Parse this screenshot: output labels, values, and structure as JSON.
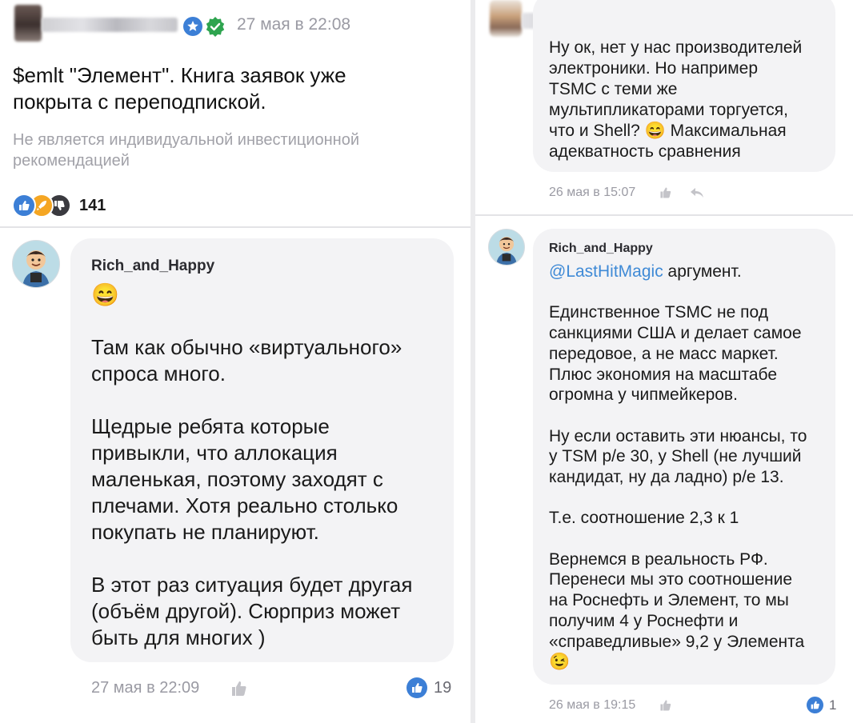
{
  "left": {
    "post": {
      "timestamp": "27 мая в 22:08",
      "text_line1": "$emlt \"Элемент\". Книга заявок уже",
      "text_line2": "покрыта с переподпиской.",
      "disclaimer_line1": "Не является индивидуальной инвестиционной",
      "disclaimer_line2": "рекомендацией",
      "reactions_count": "141"
    },
    "comment": {
      "author": "Rich_and_Happy",
      "emoji": "😄",
      "p1_l1": "Там как обычно «виртуального»",
      "p1_l2": "спроса много.",
      "p2_l1": "Щедрые ребята которые",
      "p2_l2": "привыкли, что аллокация",
      "p2_l3": "маленькая, поэтому заходят с",
      "p2_l4": "плечами. Хотя реально столько",
      "p2_l5": "покупать не планируют.",
      "p3_l1": "В этот раз ситуация будет другая",
      "p3_l2": "(объём другой). Сюрприз может",
      "p3_l3": "быть для многих )",
      "timestamp": "27 мая в 22:09",
      "likes": "19"
    }
  },
  "right": {
    "comment1": {
      "l1": "Ну ок, нет у нас производителей",
      "l2": "электроники. Но например",
      "l3": "TSMC с теми же",
      "l4": "мультипликаторами торгуется,",
      "l5a": "что и Shell?",
      "l5emoji": "😄",
      "l5b": "Максимальная",
      "l6": "адекватность сравнения",
      "timestamp": "26 мая в 15:07"
    },
    "comment2": {
      "author": "Rich_and_Happy",
      "mention": "@LastHitMagic",
      "mention_rest": " аргумент.",
      "a1": "Единственное TSMC не под",
      "a2": "санкциями США и делает самое",
      "a3": "передовое, а не масс маркет.",
      "a4": "Плюс экономия на масштабе",
      "a5": "огромна у чипмейкеров.",
      "b1": "Ну если оставить эти нюансы, то",
      "b2": "у TSM p/e 30, у Shell (не лучший",
      "b3": "кандидат, ну да ладно) p/e 13.",
      "c1": "Т.е. соотношение 2,3 к 1",
      "d1": "Вернемся в реальность РФ.",
      "d2": "Перенеси мы это соотношение",
      "d3": "на Роснефть и Элемент, то мы",
      "d4": "получим 4 у Роснефти и",
      "d5": "«справедливые» 9,2 у Элемента",
      "emoji_end": "😉",
      "timestamp": "26 мая в 19:15",
      "likes": "1"
    }
  },
  "colors": {
    "accent_blue": "#3c7fd6",
    "verified_green": "#2ea44f",
    "muted_text": "#9a9aa3",
    "bubble_bg": "#f3f3f5"
  },
  "icons": [
    "shield-badge-icon",
    "verified-check-icon",
    "like-icon",
    "rocket-icon",
    "dislike-icon",
    "thumbs-up-icon",
    "reply-icon"
  ]
}
